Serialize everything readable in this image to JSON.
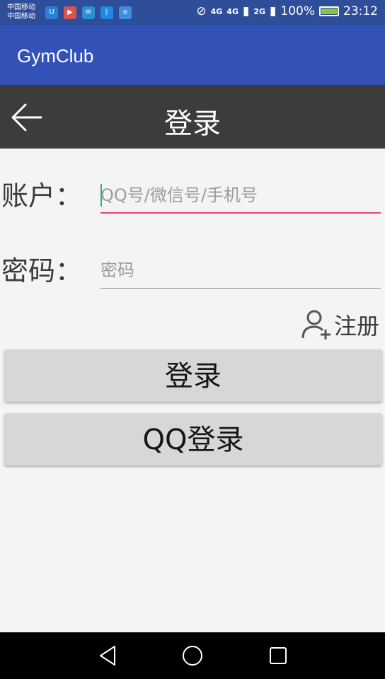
{
  "statusbar": {
    "carrier_1": "中国移动",
    "carrier_2": "中国移动",
    "net_1": "4G",
    "net_2": "4G",
    "net_3": "2G",
    "battery": "100%",
    "time": "23:12"
  },
  "appbar": {
    "title": "GymClub"
  },
  "subbar": {
    "title": "登录"
  },
  "account": {
    "label": "账户：",
    "placeholder": "QQ号/微信号/手机号"
  },
  "password": {
    "label": "密码：",
    "placeholder": "密码"
  },
  "register": {
    "label": "注册"
  },
  "buttons": {
    "login": "登录",
    "qq_login": "QQ登录"
  },
  "colors": {
    "statusbar": "#2f4e9a",
    "appbar": "#3352b8",
    "subbar": "#3c3c3a",
    "accent_underline": "#e0476c",
    "button": "#d7d7d7"
  }
}
